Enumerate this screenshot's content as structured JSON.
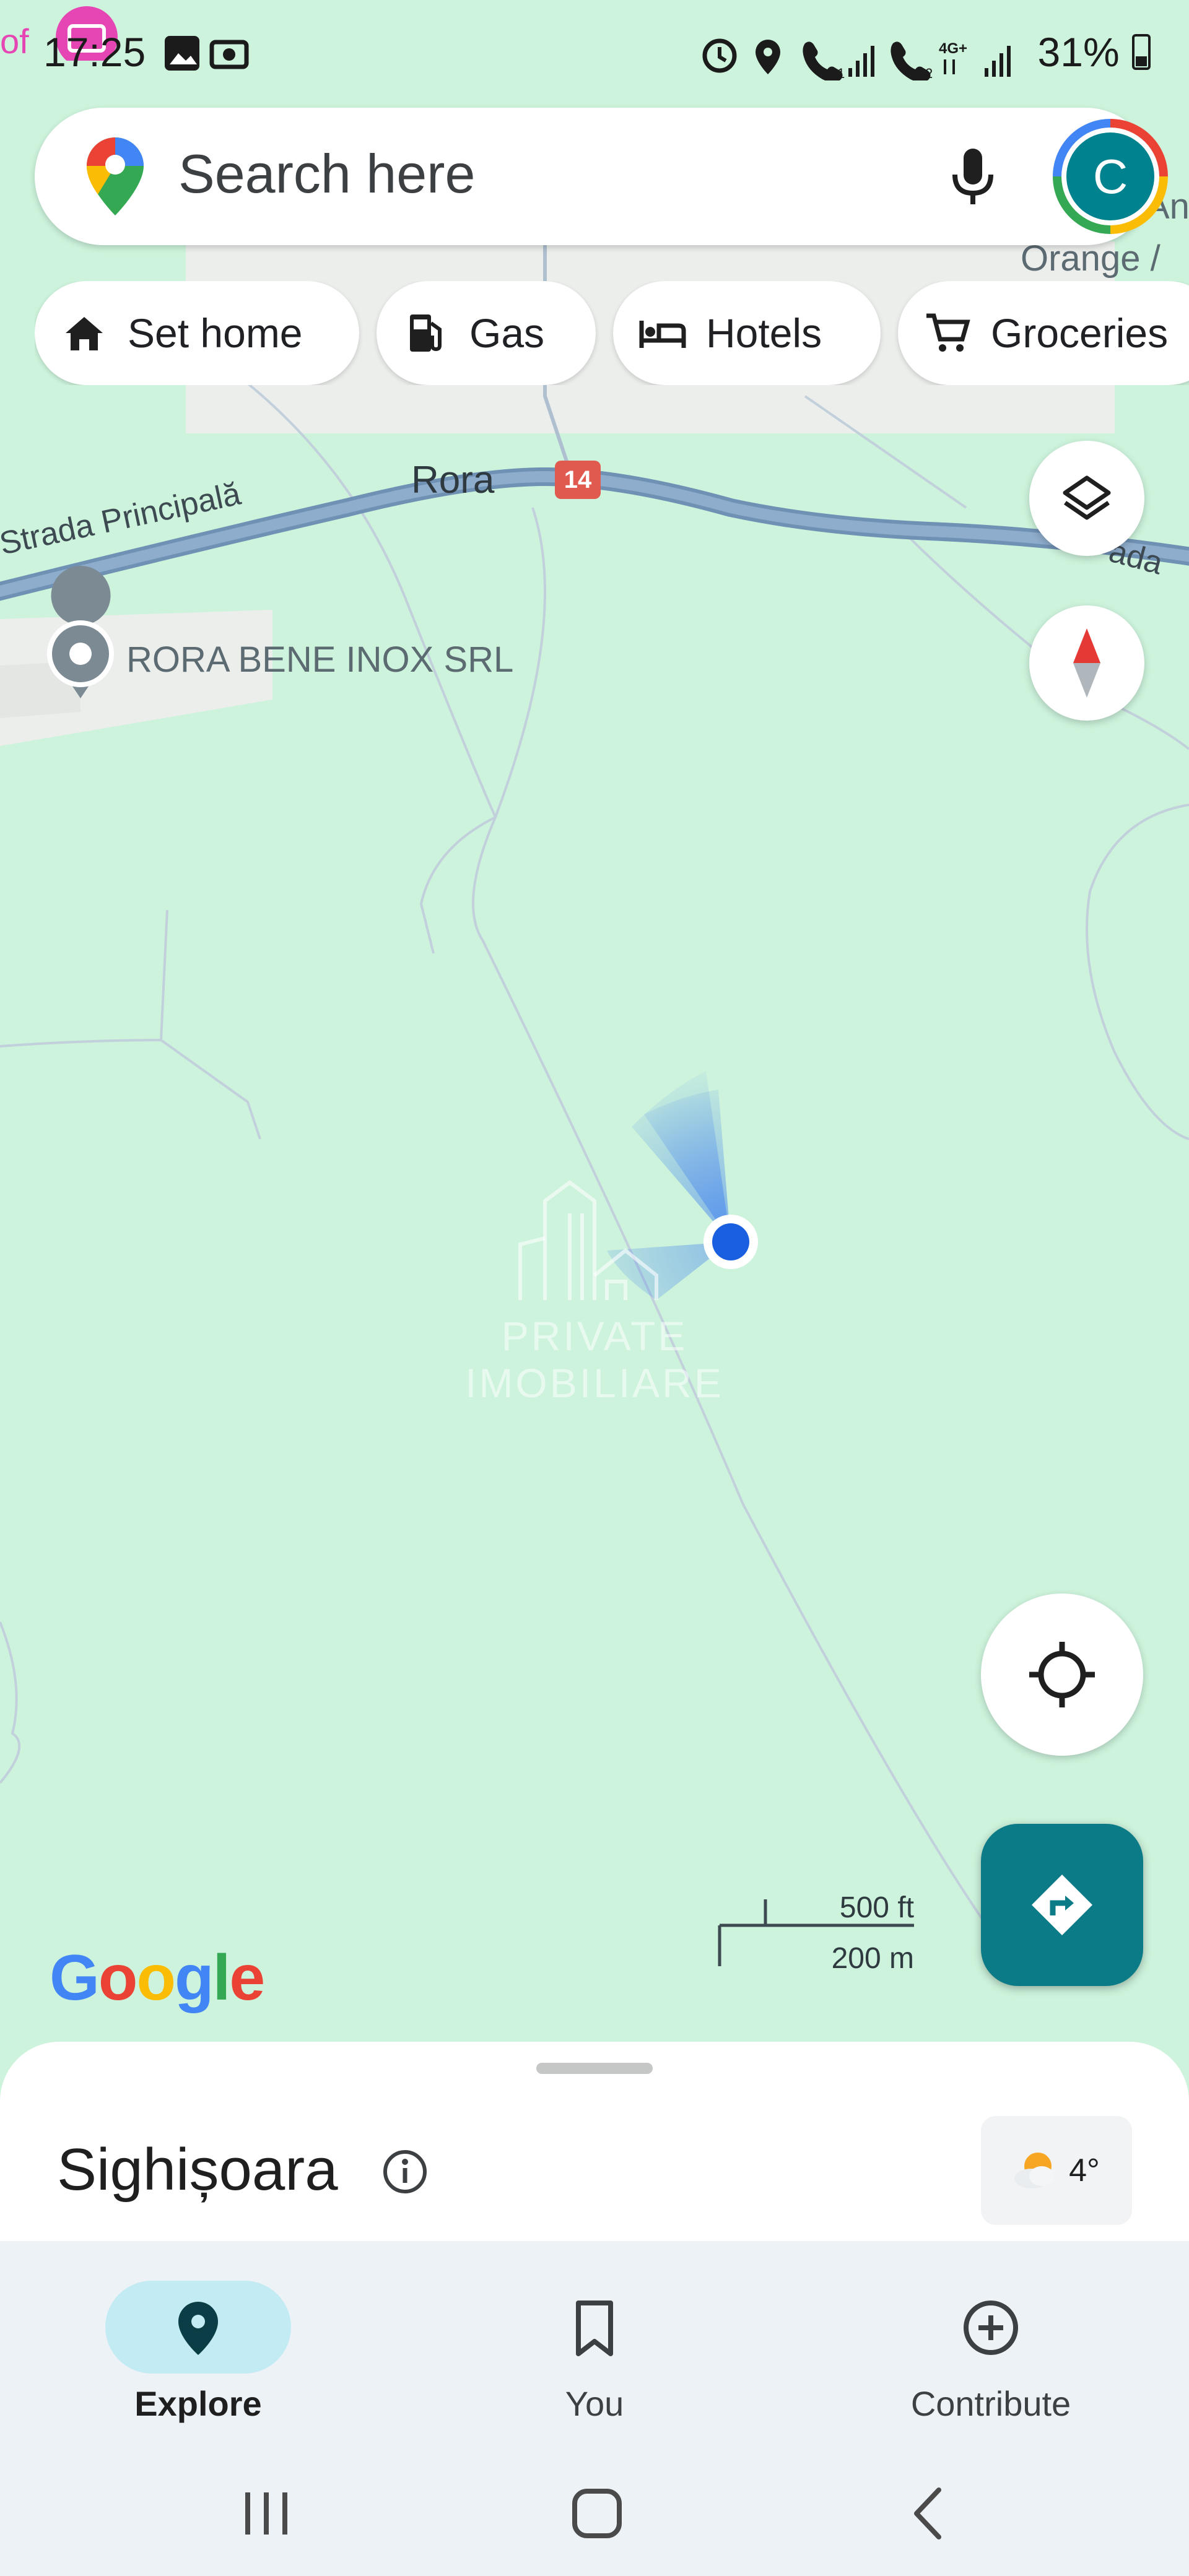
{
  "status_bar": {
    "time": "17:25",
    "battery": "31%",
    "icons": [
      "notification-bubble-icon",
      "gallery-icon",
      "camera-icon",
      "alarm-icon",
      "location-icon",
      "call-sim1-icon",
      "signal-icon",
      "call-sim2-icon",
      "4g-icon",
      "signal-icon",
      "battery-icon"
    ]
  },
  "search": {
    "placeholder": "Search here",
    "avatar_letter": "C"
  },
  "chips": [
    {
      "label": "Set home",
      "icon": "home-icon"
    },
    {
      "label": "Gas",
      "icon": "gas-station-icon"
    },
    {
      "label": "Hotels",
      "icon": "hotel-bed-icon"
    },
    {
      "label": "Groceries",
      "icon": "shopping-cart-icon"
    }
  ],
  "map": {
    "road_label_main": "Rora",
    "road_label_left": "Strada Principală",
    "road_label_right": "ada",
    "route_shield": "14",
    "poi_label": "RORA BENE INOX SRL",
    "poi_label_2": "Orange /",
    "poi_label_3": "Ant",
    "watermark_text": "PRIVATE IMOBILIARE",
    "google_logo": "Google",
    "scale_ft": "500 ft",
    "scale_m": "200 m",
    "colors": {
      "land": "#cdf3dc",
      "road": "#7f9fbd",
      "route_shield": "#e05a4f",
      "location_dot": "#1a5fe0",
      "accent": "#0b7b87"
    }
  },
  "sheet": {
    "place_name": "Sighișoara",
    "weather_temp": "4°"
  },
  "bottom_nav": {
    "items": [
      {
        "label": "Explore",
        "icon": "explore-pin-icon",
        "selected": true
      },
      {
        "label": "You",
        "icon": "bookmark-icon",
        "selected": false
      },
      {
        "label": "Contribute",
        "icon": "plus-circle-icon",
        "selected": false
      }
    ]
  }
}
